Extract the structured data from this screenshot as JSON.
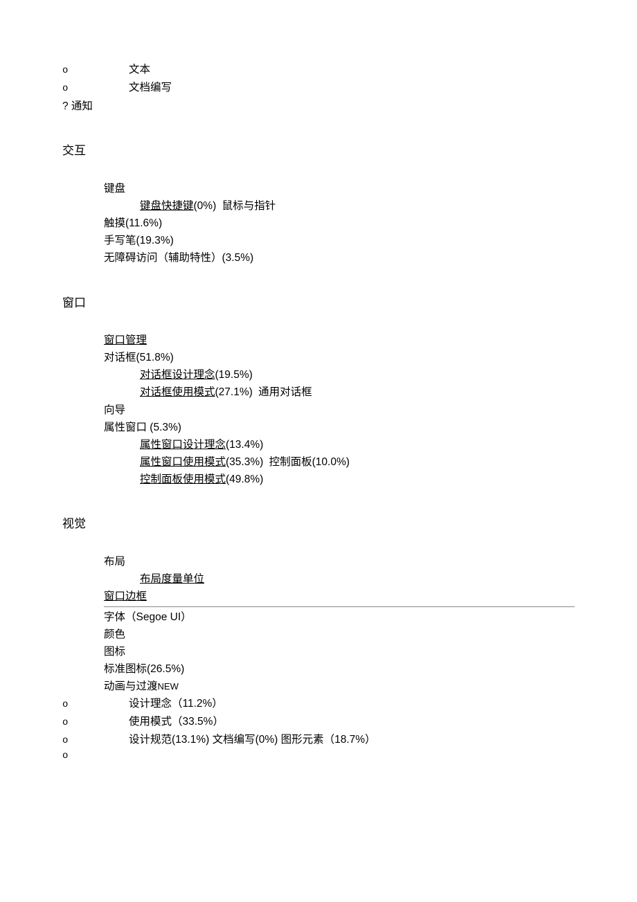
{
  "top": {
    "bullets": [
      "文本",
      "文档编写"
    ],
    "qline": "? 通知"
  },
  "sections": {
    "interaction": {
      "title": "交互",
      "items": {
        "keyboard": "键盘",
        "keyboard_shortcut_link": "键盘快捷键",
        "keyboard_shortcut_pct": "(0%)",
        "mouse": "鼠标与指针",
        "touch": "触摸(11.6%)",
        "stylus": "手写笔(19.3%)",
        "accessibility": "无障碍访问（辅助特性）(3.5%)"
      }
    },
    "window": {
      "title": "窗口",
      "items": {
        "mgmt": "窗口管理",
        "dialog": "对话框(51.8%)",
        "dialog_design_link": "对话框设计理念",
        "dialog_design_pct": "(19.5%)",
        "dialog_pattern_link": "对话框使用模式",
        "dialog_pattern_pct": "(27.1%)",
        "common_dialog": "通用对话框",
        "wizard": "向导",
        "prop_win": "属性窗口  (5.3%)",
        "prop_design_link": "属性窗口设计理念",
        "prop_design_pct": "(13.4%)",
        "prop_pattern_link": "属性窗口使用模式",
        "prop_pattern_pct": "(35.3%)",
        "ctrl_panel": "控制面板(10.0%)",
        "ctrl_panel_pattern_link": "控制面板使用模式",
        "ctrl_panel_pattern_pct": "(49.8%)"
      }
    },
    "visual": {
      "title": "视觉",
      "items": {
        "layout": "布局",
        "layout_unit": "布局度量单位",
        "frame": "窗口边框",
        "font": "字体（Segoe UI）",
        "color": "颜色",
        "icon": "图标",
        "std_icon": "标准图标(26.5%)",
        "anim": "动画与过渡",
        "new_tag": "NEW",
        "b1": "设计理念（11.2%）",
        "b2": "使用模式（33.5%）",
        "b3": "设计规范(13.1%) 文档编写(0%) 图形元素（18.7%）",
        "b4": ""
      }
    }
  }
}
